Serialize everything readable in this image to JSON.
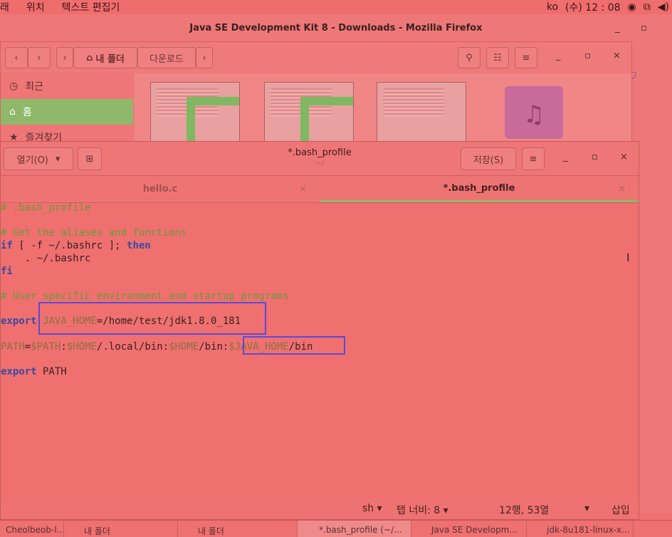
{
  "top_panel": {
    "menu_items": [
      "래",
      "위치",
      "텍스트 편집기"
    ],
    "language": "ko",
    "clock": "(수) 12 : 08"
  },
  "firefox": {
    "title": "Java SE Development Kit 8 - Downloads - Mozilla Firefox"
  },
  "files": {
    "path": [
      "내 폴더",
      "다운로드"
    ],
    "sidebar": [
      "최근",
      "홈",
      "즐겨찾기"
    ]
  },
  "gedit": {
    "open_label": "열기(O)",
    "title": "*.bash_profile",
    "subtitle": "~/",
    "save_label": "저장(S)",
    "tabs": [
      {
        "label": "hello.c",
        "active": false
      },
      {
        "label": "*.bash_profile",
        "active": true
      }
    ],
    "lines": [
      [
        {
          "t": "# .bash_profile",
          "c": "comment"
        }
      ],
      [],
      [
        {
          "t": "# Get the aliases and functions",
          "c": "comment"
        }
      ],
      [
        {
          "t": "if",
          "c": "kw"
        },
        {
          "t": " [ -f ~/.bashrc ]; ",
          "c": "plain"
        },
        {
          "t": "then",
          "c": "kw"
        }
      ],
      [
        {
          "t": "    . ~/.bashrc",
          "c": "plain"
        }
      ],
      [
        {
          "t": "fi",
          "c": "kw"
        }
      ],
      [],
      [
        {
          "t": "# User specific environment and startup programs",
          "c": "comment"
        }
      ],
      [],
      [
        {
          "t": "export",
          "c": "kw"
        },
        {
          "t": " ",
          "c": "plain"
        },
        {
          "t": "JAVA_HOME",
          "c": "var"
        },
        {
          "t": "=/home/test/jdk1.8.0_181",
          "c": "plain"
        }
      ],
      [],
      [
        {
          "t": "PATH",
          "c": "var"
        },
        {
          "t": "=",
          "c": "plain"
        },
        {
          "t": "$PATH",
          "c": "var"
        },
        {
          "t": ":",
          "c": "plain"
        },
        {
          "t": "$HOME",
          "c": "var"
        },
        {
          "t": "/.local/bin:",
          "c": "plain"
        },
        {
          "t": "$HOME",
          "c": "var"
        },
        {
          "t": "/bin:",
          "c": "plain"
        },
        {
          "t": "$JAVA_HOME",
          "c": "var"
        },
        {
          "t": "/bin",
          "c": "plain"
        }
      ],
      [],
      [
        {
          "t": "export",
          "c": "kw"
        },
        {
          "t": " PATH",
          "c": "plain"
        }
      ]
    ],
    "status": {
      "language": "sh",
      "tab_width": "탭 너비: 8",
      "position": "12행, 53열",
      "mode": "삽입"
    }
  },
  "taskbar": [
    "Cheolbeob-l...",
    "내 폴더",
    "내 폴더",
    "*.bash_profile (~/...",
    "Java SE Developm...",
    "jdk-8u181-linux-x..."
  ],
  "colors": {
    "accent_green": "#8fb86a",
    "highlight_box": "#5a4ad8"
  }
}
